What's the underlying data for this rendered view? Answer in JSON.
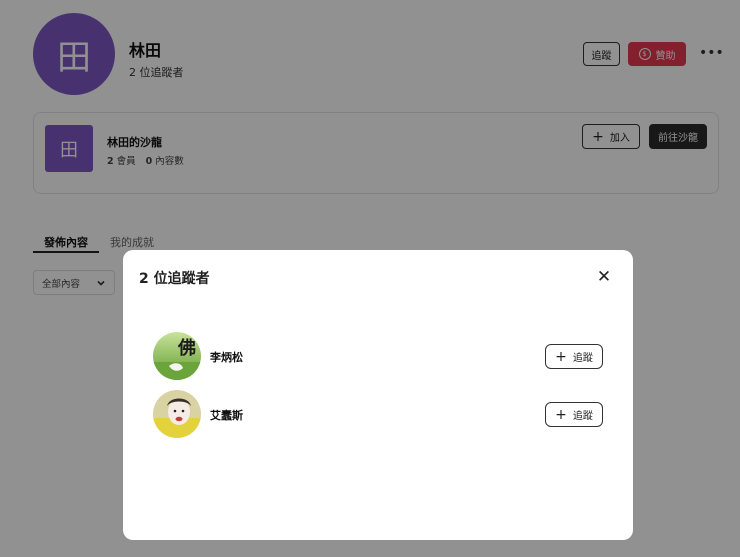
{
  "profile": {
    "avatar_glyph": "田",
    "name": "林田",
    "followers_text": "2 位追蹤者",
    "follow_label": "追蹤",
    "sponsor_label": "贊助",
    "sponsor_icon": "$",
    "more_icon": "•••"
  },
  "salon": {
    "avatar_glyph": "田",
    "title": "林田的沙龍",
    "members_count": "2",
    "members_label": "會員",
    "content_count": "0",
    "content_label": "內容數",
    "join_label": "加入",
    "goto_label": "前往沙龍"
  },
  "tabs": [
    {
      "label": "發佈內容"
    },
    {
      "label": "我的成就"
    }
  ],
  "filter": {
    "selected": "全部內容"
  },
  "modal": {
    "title": "2 位追蹤者",
    "close_icon": "✕",
    "followers": [
      {
        "name": "李炳松",
        "follow_label": "追蹤",
        "avatar_glyph": "佛"
      },
      {
        "name": "艾蠢斯",
        "follow_label": "追蹤"
      }
    ]
  },
  "colors": {
    "accent_purple": "#7e57c2",
    "sponsor_red": "#e53950",
    "dark_button": "#2b2b2b"
  }
}
